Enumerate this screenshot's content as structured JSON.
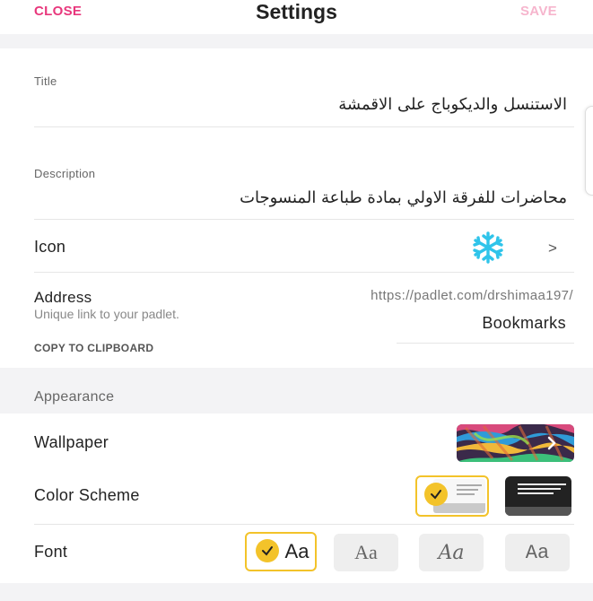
{
  "header": {
    "close_label": "CLOSE",
    "title": "Settings",
    "save_label": "SAVE"
  },
  "form": {
    "title_label": "Title",
    "title_value": "الاستنسل والديكوباج على الاقمشة",
    "description_label": "Description",
    "description_value": "محاضرات للفرقة الاولي بمادة طباعة المنسوجات",
    "icon_label": "Icon",
    "icon_name": "snowflake-icon",
    "icon_color": "#2fc4ea",
    "address_label": "Address",
    "address_help": "Unique link to your padlet.",
    "copy_label": "COPY TO CLIPBOARD",
    "address_prefix": "https://padlet.com/drshimaa197/",
    "address_slug": "Bookmarks"
  },
  "appearance": {
    "section_label": "Appearance",
    "wallpaper_label": "Wallpaper",
    "color_scheme_label": "Color Scheme",
    "color_scheme_options": [
      "light",
      "dark"
    ],
    "color_scheme_selected": "light",
    "font_label": "Font",
    "font_options": [
      "Aa",
      "Aa",
      "Aa",
      "Aa"
    ],
    "font_selected_index": 0
  },
  "colors": {
    "accent": "#e8377c",
    "accent_disabled": "#f6b5cd",
    "selected": "#f3c32a"
  }
}
